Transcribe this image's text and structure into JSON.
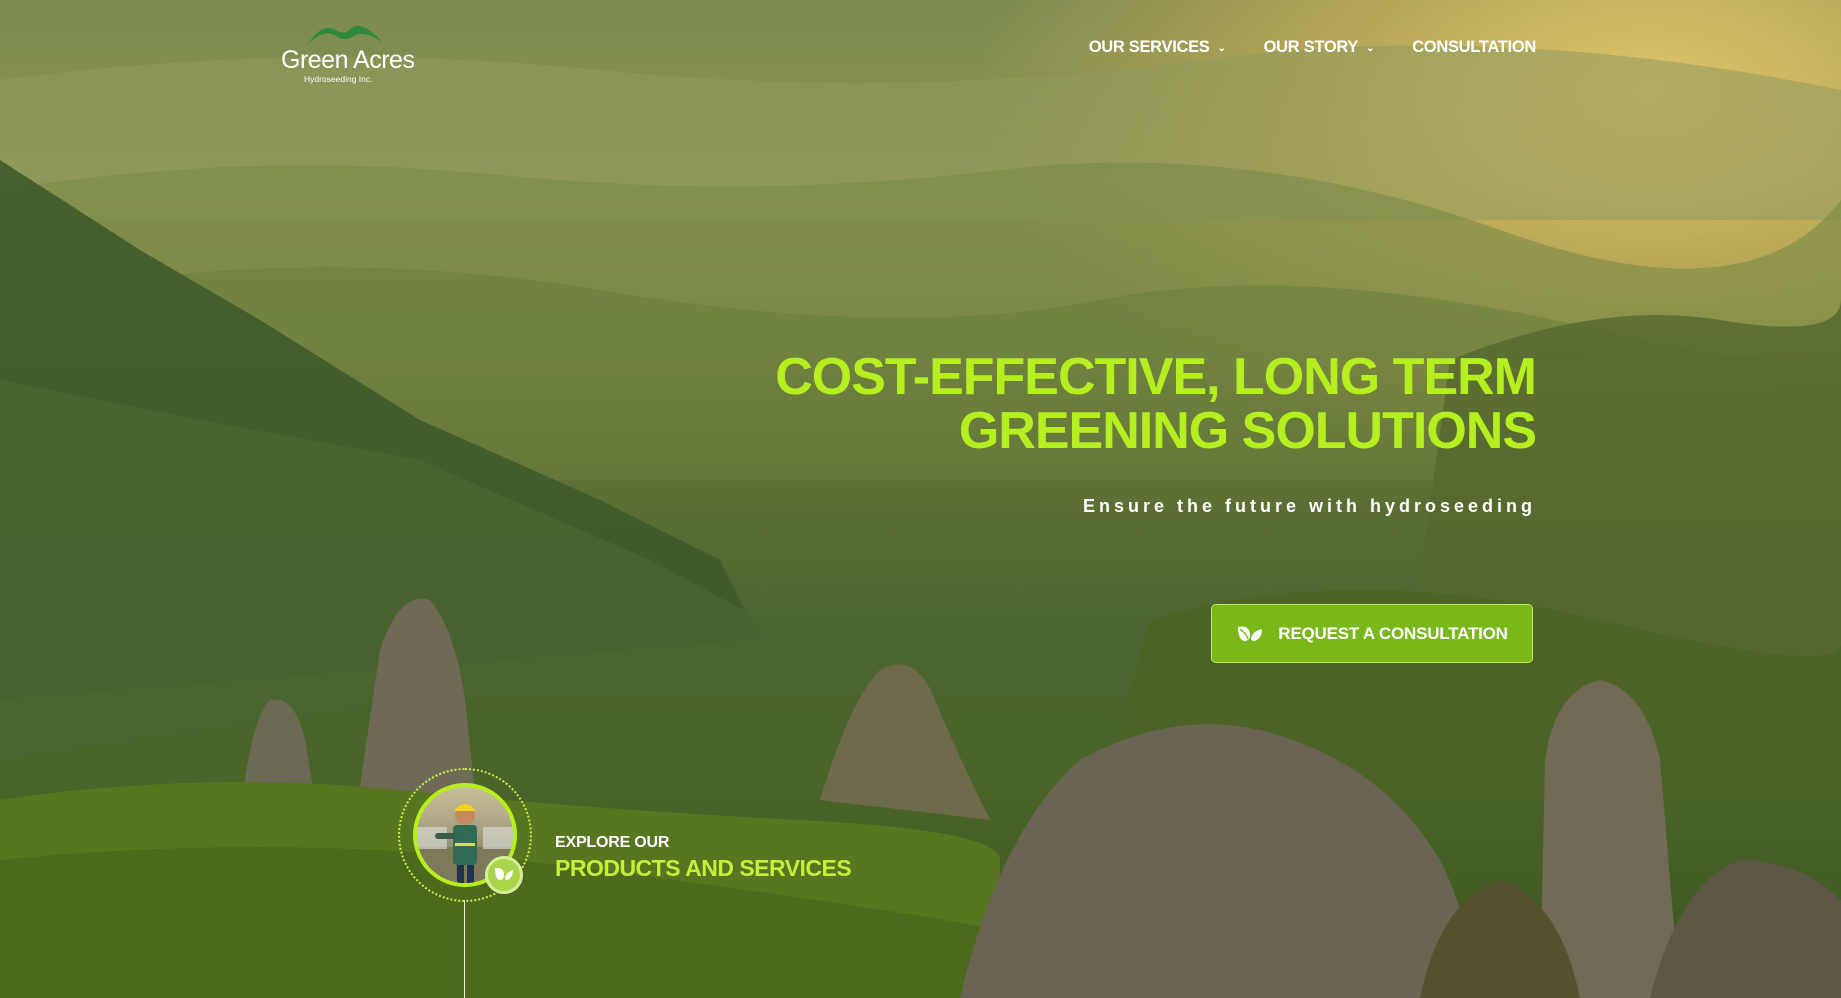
{
  "brand": {
    "name": "Green Acres",
    "subtitle": "Hydroseeding Inc.",
    "logo_icon": "mountain-logo-icon",
    "accent_color": "#b5ef1f",
    "button_color": "#7ab718"
  },
  "nav": {
    "items": [
      {
        "label": "OUR SERVICES",
        "has_dropdown": true
      },
      {
        "label": "OUR STORY",
        "has_dropdown": true
      },
      {
        "label": "CONSULTATION",
        "has_dropdown": false
      }
    ],
    "dropdown_icon": "chevron-down-icon"
  },
  "hero": {
    "headline_line1": "COST-EFFECTIVE, LONG TERM",
    "headline_line2": "GREENING SOLUTIONS",
    "tagline": "Ensure the future with hydroseeding",
    "cta_label": "REQUEST A CONSULTATION",
    "cta_icon": "leaf-icon"
  },
  "explore": {
    "small_label": "EXPLORE OUR",
    "big_label": "PRODUCTS AND SERVICES",
    "badge_icon": "leaf-icon"
  }
}
